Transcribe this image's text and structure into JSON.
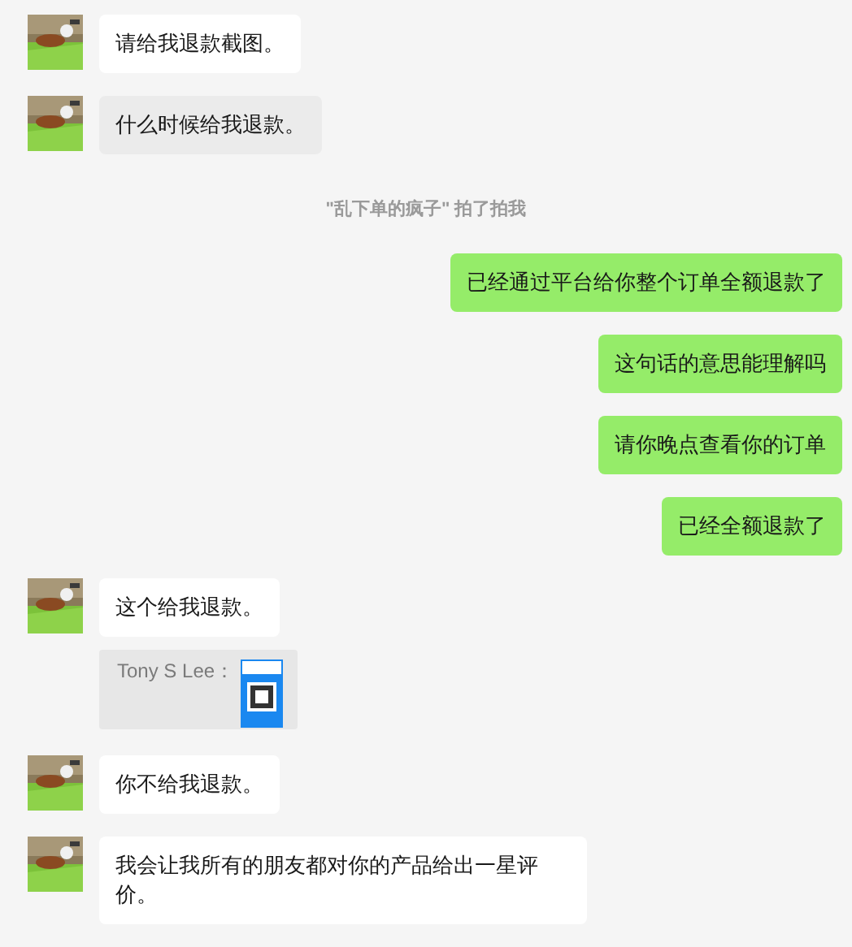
{
  "messages": [
    {
      "kind": "incoming",
      "text": "请给我退款截图。",
      "selected": false
    },
    {
      "kind": "incoming",
      "text": "什么时候给我退款。",
      "selected": true
    },
    {
      "kind": "tip",
      "text": "\"乱下单的疯子\" 拍了拍我"
    },
    {
      "kind": "outgoing",
      "text": "已经通过平台给你整个订单全额退款了",
      "selected": false
    },
    {
      "kind": "outgoing",
      "text": "这句话的意思能理解吗",
      "selected": false
    },
    {
      "kind": "outgoing",
      "text": "请你晚点查看你的订单",
      "selected": false
    },
    {
      "kind": "outgoing",
      "text": "已经全额退款了",
      "selected": false
    },
    {
      "kind": "incoming",
      "text": "这个给我退款。",
      "selected": false
    },
    {
      "kind": "quote",
      "text": "Tony S Lee："
    },
    {
      "kind": "incoming",
      "text": "你不给我退款。",
      "selected": false
    },
    {
      "kind": "incoming",
      "text": "我会让我所有的朋友都对你的产品给出一星评价。",
      "selected": false
    }
  ]
}
